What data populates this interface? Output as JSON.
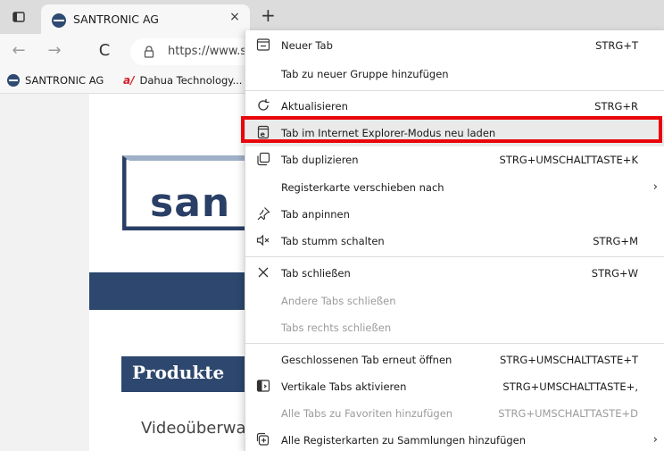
{
  "browser": {
    "tab": {
      "title": "SANTRONIC AG",
      "close": "×"
    },
    "new_tab": "+",
    "nav": {
      "back": "←",
      "forward": "→",
      "refresh": "C"
    },
    "address": {
      "url": "https://www.sa"
    },
    "bookmarks": [
      {
        "label": "SANTRONIC AG"
      },
      {
        "label": "Dahua Technology..."
      }
    ],
    "bookmark_dahua_glyph": "a/"
  },
  "page": {
    "logo_text": "san",
    "produkte": "Produkte",
    "video": "Videoüberwa"
  },
  "menu": {
    "items": [
      {
        "label": "Neuer Tab",
        "shortcut": "STRG+T",
        "icon": "new-tab-icon"
      },
      {
        "label": "Tab zu neuer Gruppe hinzufügen",
        "shortcut": ""
      },
      {
        "label": "Aktualisieren",
        "shortcut": "STRG+R",
        "icon": "refresh-icon"
      },
      {
        "label": "Tab im Internet Explorer-Modus neu laden",
        "shortcut": "",
        "icon": "ie-mode-icon",
        "highlighted": true
      },
      {
        "label": "Tab duplizieren",
        "shortcut": "STRG+UMSCHALTTASTE+K",
        "icon": "duplicate-icon"
      },
      {
        "label": "Registerkarte verschieben nach",
        "shortcut": "",
        "submenu": "›"
      },
      {
        "label": "Tab anpinnen",
        "shortcut": "",
        "icon": "pin-icon"
      },
      {
        "label": "Tab stumm schalten",
        "shortcut": "STRG+M",
        "icon": "mute-icon"
      },
      {
        "label": "Tab schließen",
        "shortcut": "STRG+W",
        "icon": "close-icon"
      },
      {
        "label": "Andere Tabs schließen",
        "shortcut": "",
        "disabled": true
      },
      {
        "label": "Tabs rechts schließen",
        "shortcut": "",
        "disabled": true
      },
      {
        "label": "Geschlossenen Tab erneut öffnen",
        "shortcut": "STRG+UMSCHALTTASTE+T"
      },
      {
        "label": "Vertikale Tabs aktivieren",
        "shortcut": "STRG+UMSCHALTTASTE+,",
        "icon": "vertical-tabs-icon"
      },
      {
        "label": "Alle Tabs zu Favoriten hinzufügen",
        "shortcut": "STRG+UMSCHALTTASTE+D",
        "disabled": true
      },
      {
        "label": "Alle Registerkarten zu Sammlungen hinzufügen",
        "shortcut": "",
        "icon": "collections-icon",
        "submenu": "›"
      }
    ]
  },
  "colors": {
    "highlight_border": "#e8060b",
    "brand_blue": "#2d476e"
  }
}
